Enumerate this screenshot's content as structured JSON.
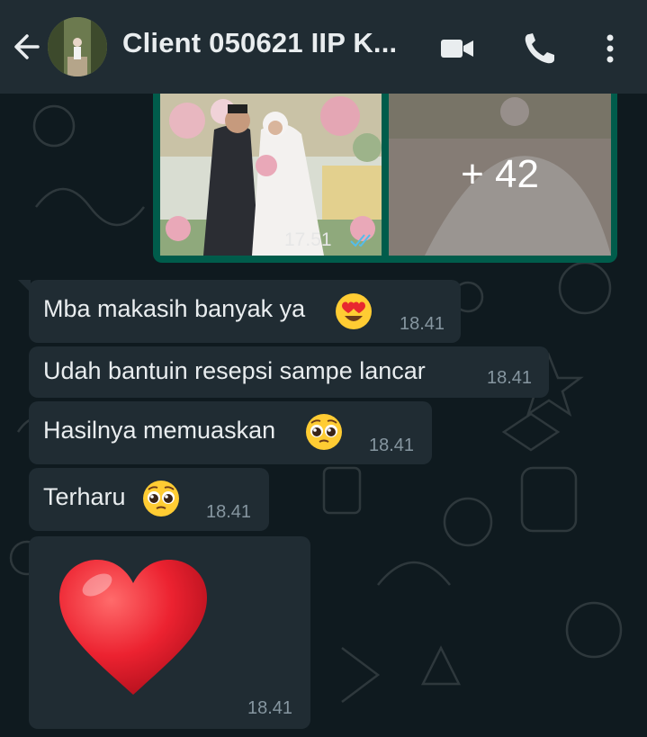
{
  "header": {
    "title": "Client 050621 IIP K...",
    "icons": [
      "back-arrow-icon",
      "video-call-icon",
      "voice-call-icon",
      "more-options-icon"
    ]
  },
  "media": {
    "overflow_count": "+ 42",
    "time": "17.51",
    "status": "read"
  },
  "messages": [
    {
      "text": "Mba makasih banyak ya",
      "emoji": "heart-eyes",
      "time": "18.41"
    },
    {
      "text": "Udah bantuin resepsi sampe lancar",
      "emoji": "",
      "time": "18.41"
    },
    {
      "text": "Hasilnya memuaskan",
      "emoji": "pleading-face",
      "time": "18.41"
    },
    {
      "text": "Terharu",
      "emoji": "pleading-face",
      "time": "18.41"
    },
    {
      "text": "",
      "emoji": "red-heart",
      "time": "18.41"
    }
  ],
  "colors": {
    "header_bg": "#202c33",
    "incoming_bubble": "#202c33",
    "outgoing_media_border": "#005c4b",
    "read_tick": "#53bdeb"
  }
}
